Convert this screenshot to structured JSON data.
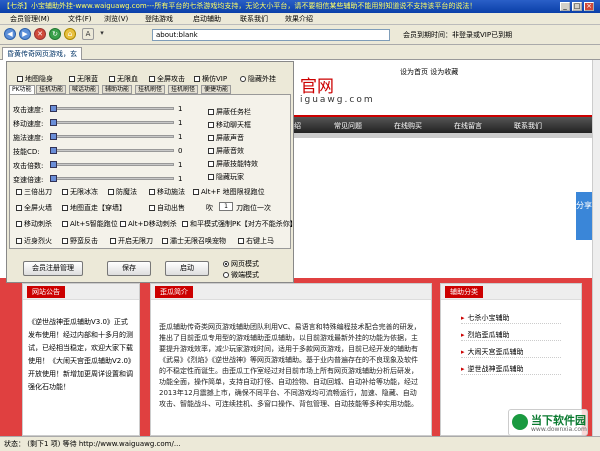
{
  "window": {
    "title": "【七杀】小宝辅助外挂-www.waiguawg.com---所有平台的七杀游戏均支持，无论大小平台，请不要相信某些辅助不能用别知道说不支持该平台的说法！",
    "min": "_",
    "max": "□",
    "close": "×"
  },
  "menu": [
    "会员管理(M)",
    "文件(F)",
    "浏览(V)",
    "登陆游戏",
    "启动辅助",
    "联系我们",
    "效果介绍"
  ],
  "toolbar": {
    "address": "about:blank",
    "vip_info": "会员到期时间：非登录或VIP已到期"
  },
  "tab": {
    "label": "昏黄传奇网页游戏，玄"
  },
  "website": {
    "logo": "官网",
    "logo_url": "iguawg.com",
    "top_links": "设为首页  设为收藏",
    "nav": [
      "绍",
      "常见问题",
      "在线购买",
      "在线留言",
      "联系我们"
    ],
    "box1": {
      "title": "网站公告",
      "text": "《逆世战神歪瓜辅助V3.0》正式发布使用！经过内部和十多月的测试，已经相当稳定，欢迎大家下载使用！《大闹天宫歪瓜辅助V2.0》开放使用！新增加更周详设置和调强化石功能！"
    },
    "box2": {
      "title": "歪瓜简介",
      "text": "歪瓜辅助传奇类网页游戏辅助团队利用VC、易语言和特殊编程技术配合完善的研发，推出了目前歪瓜专用型的游戏辅助歪瓜辅助，以目前游戏最新外挂的功能为依据，主要提升游戏效率，减少玩家游戏时间，适用于多款网页游戏，目前已经开发的辅助有《武易》《烈焰》《逆世战神》等网页游戏辅助。基于业内普遍存在的不良现象及软件的不稳定性而诞生。由歪瓜工作室经过对目前市场上所有网页游戏辅助分析后研发，功能全面，操作简单，支持自动打怪、自动捡物、自动回城、自动补给等功能，经过2013年12月震撼上市，确保不同平台、不同游戏均可流畅运行，加速、隐藏、自动攻击、智能战斗、可连续挂机、多窗口操作、背包管理、自动技能等多种实用功能。"
    },
    "box3": {
      "title": "辅助分类",
      "items": [
        "七杀小宝辅助",
        "烈焰歪瓜辅助",
        "大闹天宫歪瓜辅助",
        "逆世战神歪瓜辅助"
      ]
    },
    "share": "分享"
  },
  "panel": {
    "top_checks": [
      {
        "label": "地图隐身",
        "checked": false
      },
      {
        "label": "无限蓝",
        "checked": false
      },
      {
        "label": "无限血",
        "checked": false
      },
      {
        "label": "全屏攻击",
        "checked": false
      },
      {
        "label": "横仿VIP",
        "checked": false
      },
      {
        "label": "隐藏外挂",
        "checked": false
      }
    ],
    "tabs": [
      "PK功能",
      "挂机功能",
      "喊话功能",
      "辅助功能",
      "挂机刷怪",
      "挂机刷怪",
      "便捷功能"
    ],
    "active_tab": 0,
    "sliders": [
      {
        "label": "攻击速度:",
        "value": "1"
      },
      {
        "label": "移动速度:",
        "value": "1"
      },
      {
        "label": "施法速度:",
        "value": "1"
      },
      {
        "label": "技能CD:",
        "value": "0"
      },
      {
        "label": "攻击倍数:",
        "value": "1"
      },
      {
        "label": "变速倍速:",
        "value": "1"
      }
    ],
    "right_checks": [
      "屏蔽任务栏",
      "移动聊天框",
      "屏蔽声音",
      "屏蔽音效",
      "屏蔽技能特效",
      "隐藏玩家"
    ],
    "grid_rows": [
      [
        "三倍出刀",
        "无限冰冻",
        "防魔法",
        "移动施法",
        "Alt+F 地图限视跑位"
      ],
      [
        "全屏火墙",
        "地图直走【穿墙】",
        "自动出售",
        "吹",
        "刀跑位一次"
      ],
      [
        "移动刺杀",
        "Alt+S智能跑位",
        "Alt+D移动刺杀",
        "和平模式强制PK【对方不能杀你】"
      ],
      [
        "近身烈火",
        "野蛮反击",
        "开启无限刀",
        "灞士无限召唤宠物",
        "右键上马"
      ]
    ],
    "number_value": "1",
    "buttons": {
      "register": "会员注册管理",
      "save": "保存",
      "start": "启动"
    },
    "modes": [
      {
        "label": "网页模式",
        "selected": true
      },
      {
        "label": "微端模式",
        "selected": false
      }
    ]
  },
  "status": {
    "text": "状态：    (剩下1 项) 等待 http://www.waiguawg.com/..."
  },
  "watermark": {
    "name": "当下软件园",
    "url": "www.downxia.com"
  }
}
